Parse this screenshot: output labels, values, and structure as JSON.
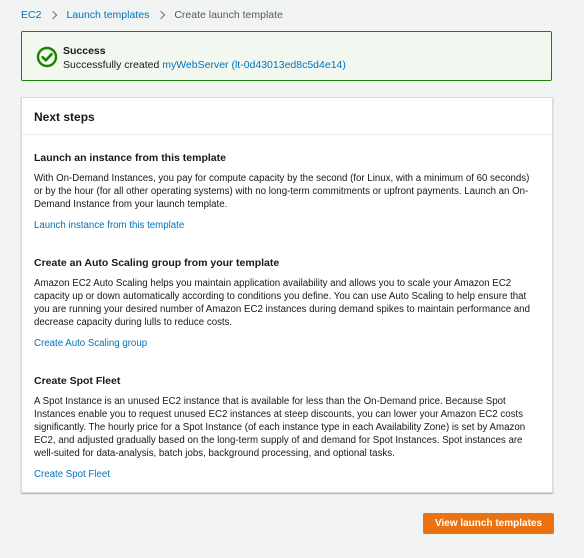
{
  "breadcrumb": {
    "items": [
      "EC2",
      "Launch templates"
    ],
    "current": "Create launch template"
  },
  "flash": {
    "icon": "success-check-icon",
    "title": "Success",
    "message_prefix": "Successfully created ",
    "link_text": "myWebServer (lt-0d43013ed8c5d4e14)",
    "color": "#1d8102"
  },
  "panel": {
    "title": "Next steps",
    "sections": [
      {
        "title": "Launch an instance from this template",
        "body": "With On-Demand Instances, you pay for compute capacity by the second (for Linux, with a minimum of 60 seconds) or by the hour (for all other operating systems) with no long-term commitments or upfront payments. Launch an On-Demand Instance from your launch template.",
        "link": "Launch instance from this template"
      },
      {
        "title": "Create an Auto Scaling group from your template",
        "body": "Amazon EC2 Auto Scaling helps you maintain application availability and allows you to scale your Amazon EC2 capacity up or down automatically according to conditions you define. You can use Auto Scaling to help ensure that you are running your desired number of Amazon EC2 instances during demand spikes to maintain performance and decrease capacity during lulls to reduce costs.",
        "link": "Create Auto Scaling group"
      },
      {
        "title": "Create Spot Fleet",
        "body": "A Spot Instance is an unused EC2 instance that is available for less than the On-Demand price. Because Spot Instances enable you to request unused EC2 instances at steep discounts, you can lower your Amazon EC2 costs significantly. The hourly price for a Spot Instance (of each instance type in each Availability Zone) is set by Amazon EC2, and adjusted gradually based on the long-term supply of and demand for Spot Instances. Spot instances are well-suited for data-analysis, batch jobs, background processing, and optional tasks.",
        "link": "Create Spot Fleet"
      }
    ]
  },
  "actions": {
    "primary_label": "View launch templates",
    "primary_color": "#ec7211"
  },
  "colors": {
    "link": "#0073bb",
    "background": "#f2f3f3"
  }
}
